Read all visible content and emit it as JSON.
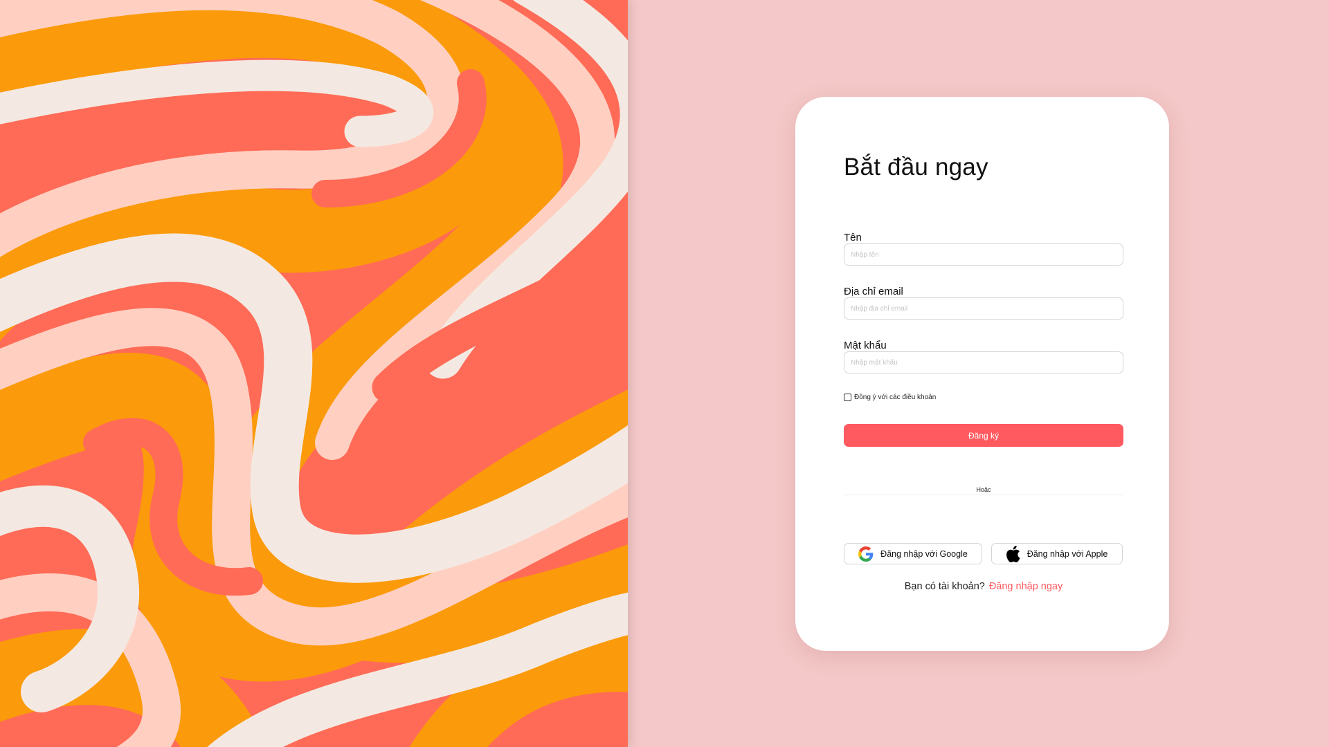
{
  "signup": {
    "title": "Bắt đầu ngay",
    "fields": [
      {
        "label": "Tên",
        "placeholder": "Nhập tên",
        "value": ""
      },
      {
        "label": "Địa chỉ email",
        "placeholder": "Nhập địa chỉ email",
        "value": ""
      },
      {
        "label": "Mật khẩu",
        "placeholder": "Nhập mật khẩu",
        "value": ""
      }
    ],
    "terms_label": "Đồng ý với các điều khoản",
    "terms_checked": false,
    "submit_label": "Đăng ký",
    "divider_text": "Hoặc",
    "google_label": "Đăng nhập với Google",
    "google_icon": "google-icon",
    "apple_label": "Đăng nhập với Apple",
    "apple_icon": "apple-icon",
    "signin_prompt": "Bạn có tài khoản?",
    "signin_link": "Đăng nhập ngay"
  },
  "colors": {
    "background": "#f4c8c8",
    "accent": "#ff5a5f",
    "card": "#ffffff",
    "art_coral": "#ff6b57",
    "art_orange": "#fb9a0a",
    "art_peach": "#ffd0c2",
    "art_cream": "#f4e9e2"
  }
}
